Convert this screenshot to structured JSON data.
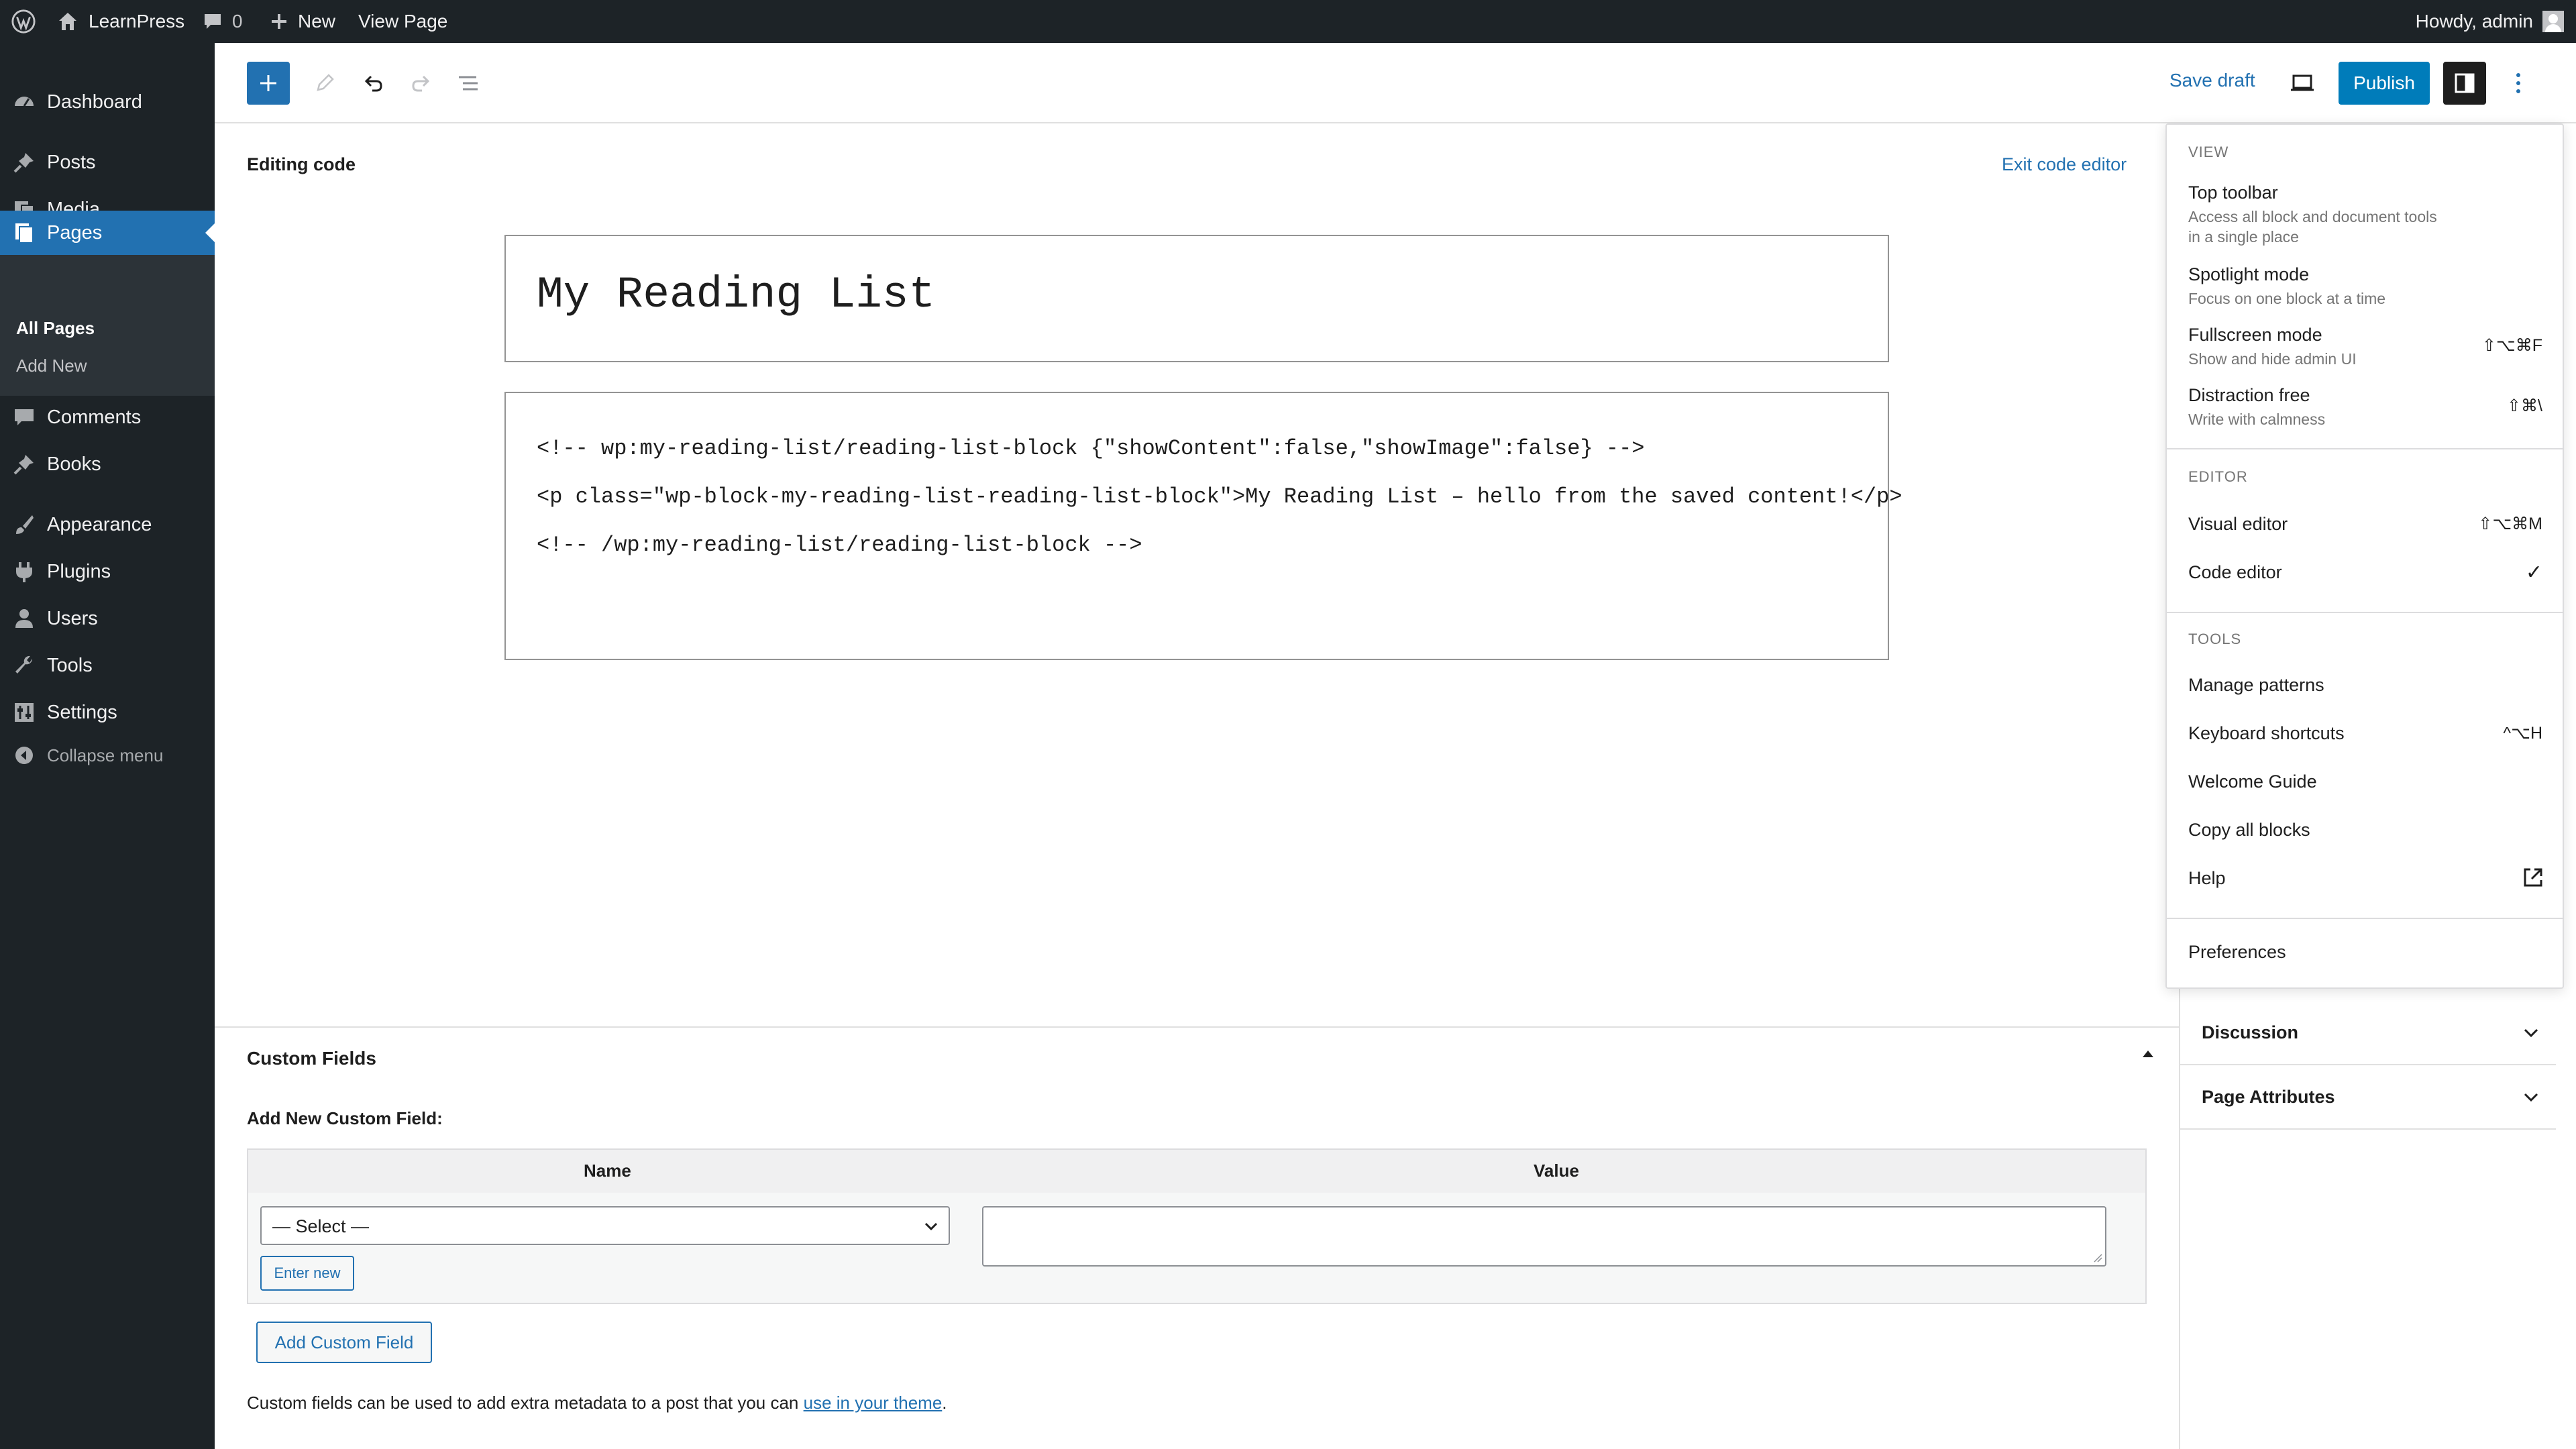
{
  "adminbar": {
    "site_name": "LearnPress",
    "comments_count": "0",
    "new_label": "New",
    "view_page_label": "View Page",
    "howdy": "Howdy, admin"
  },
  "sidebar": {
    "items": [
      {
        "label": "Dashboard",
        "icon": "dashboard-icon"
      },
      {
        "label": "Posts",
        "icon": "pin-icon"
      },
      {
        "label": "Media",
        "icon": "media-icon"
      },
      {
        "label": "Pages",
        "icon": "pages-icon"
      },
      {
        "label": "Comments",
        "icon": "comment-icon"
      },
      {
        "label": "Books",
        "icon": "pin-icon"
      },
      {
        "label": "Appearance",
        "icon": "brush-icon"
      },
      {
        "label": "Plugins",
        "icon": "plug-icon"
      },
      {
        "label": "Users",
        "icon": "user-icon"
      },
      {
        "label": "Tools",
        "icon": "wrench-icon"
      },
      {
        "label": "Settings",
        "icon": "settings-icon"
      },
      {
        "label": "Collapse menu",
        "icon": "collapse-icon"
      }
    ],
    "submenu": [
      "All Pages",
      "Add New"
    ]
  },
  "editor": {
    "save_draft": "Save draft",
    "publish": "Publish",
    "editing_code": "Editing code",
    "exit_code_editor": "Exit code editor",
    "title": "My Reading List",
    "code_lines": [
      "<!-- wp:my-reading-list/reading-list-block {\"showContent\":false,\"showImage\":false} -->",
      "<p class=\"wp-block-my-reading-list-reading-list-block\">My Reading List – hello from the saved content!</p>",
      "<!-- /wp:my-reading-list/reading-list-block -->"
    ]
  },
  "custom_fields": {
    "heading": "Custom Fields",
    "add_new_label": "Add New Custom Field:",
    "col_name": "Name",
    "col_value": "Value",
    "select_value": "— Select —",
    "enter_new": "Enter new",
    "add_button": "Add Custom Field",
    "help_prefix": "Custom fields can be used to add extra metadata to a post that you can ",
    "help_link": "use in your theme",
    "help_suffix": "."
  },
  "side_panels": {
    "discussion": "Discussion",
    "page_attributes": "Page Attributes"
  },
  "menu": {
    "view_heading": "VIEW",
    "top_toolbar": "Top toolbar",
    "top_toolbar_desc": "Access all block and document tools in a single place",
    "spotlight": "Spotlight mode",
    "spotlight_desc": "Focus on one block at a time",
    "fullscreen": "Fullscreen mode",
    "fullscreen_desc": "Show and hide admin UI",
    "fullscreen_shortcut": "⇧⌥⌘F",
    "distraction": "Distraction free",
    "distraction_desc": "Write with calmness",
    "distraction_shortcut": "⇧⌘\\",
    "editor_heading": "EDITOR",
    "visual_editor": "Visual editor",
    "visual_shortcut": "⇧⌥⌘M",
    "code_editor": "Code editor",
    "code_check": "✓",
    "tools_heading": "TOOLS",
    "manage_patterns": "Manage patterns",
    "keyboard_shortcuts": "Keyboard shortcuts",
    "keyboard_shortcut_keys": "^⌥H",
    "welcome_guide": "Welcome Guide",
    "copy_all": "Copy all blocks",
    "help": "Help",
    "preferences": "Preferences"
  },
  "colors": {
    "accent": "#2271b1",
    "publish": "#007cba",
    "admin_dark": "#1d2327"
  }
}
